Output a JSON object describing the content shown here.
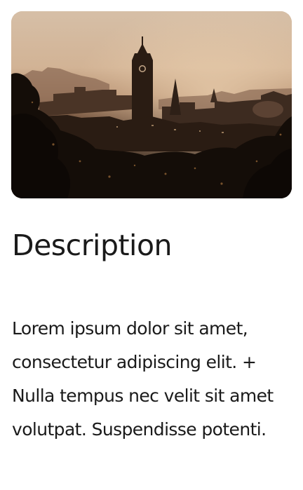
{
  "card": {
    "image_alt": "City skyline at sunset with a clock tower",
    "heading": "Description",
    "body": "Lorem ipsum dolor sit amet, consectetur adipiscing elit. + Nulla tempus nec velit sit amet volutpat. Suspendisse potenti."
  },
  "colors": {
    "text": "#1a1a1a",
    "background": "#ffffff",
    "sky": "#d8c0a6",
    "silhouette": "#140d08"
  }
}
